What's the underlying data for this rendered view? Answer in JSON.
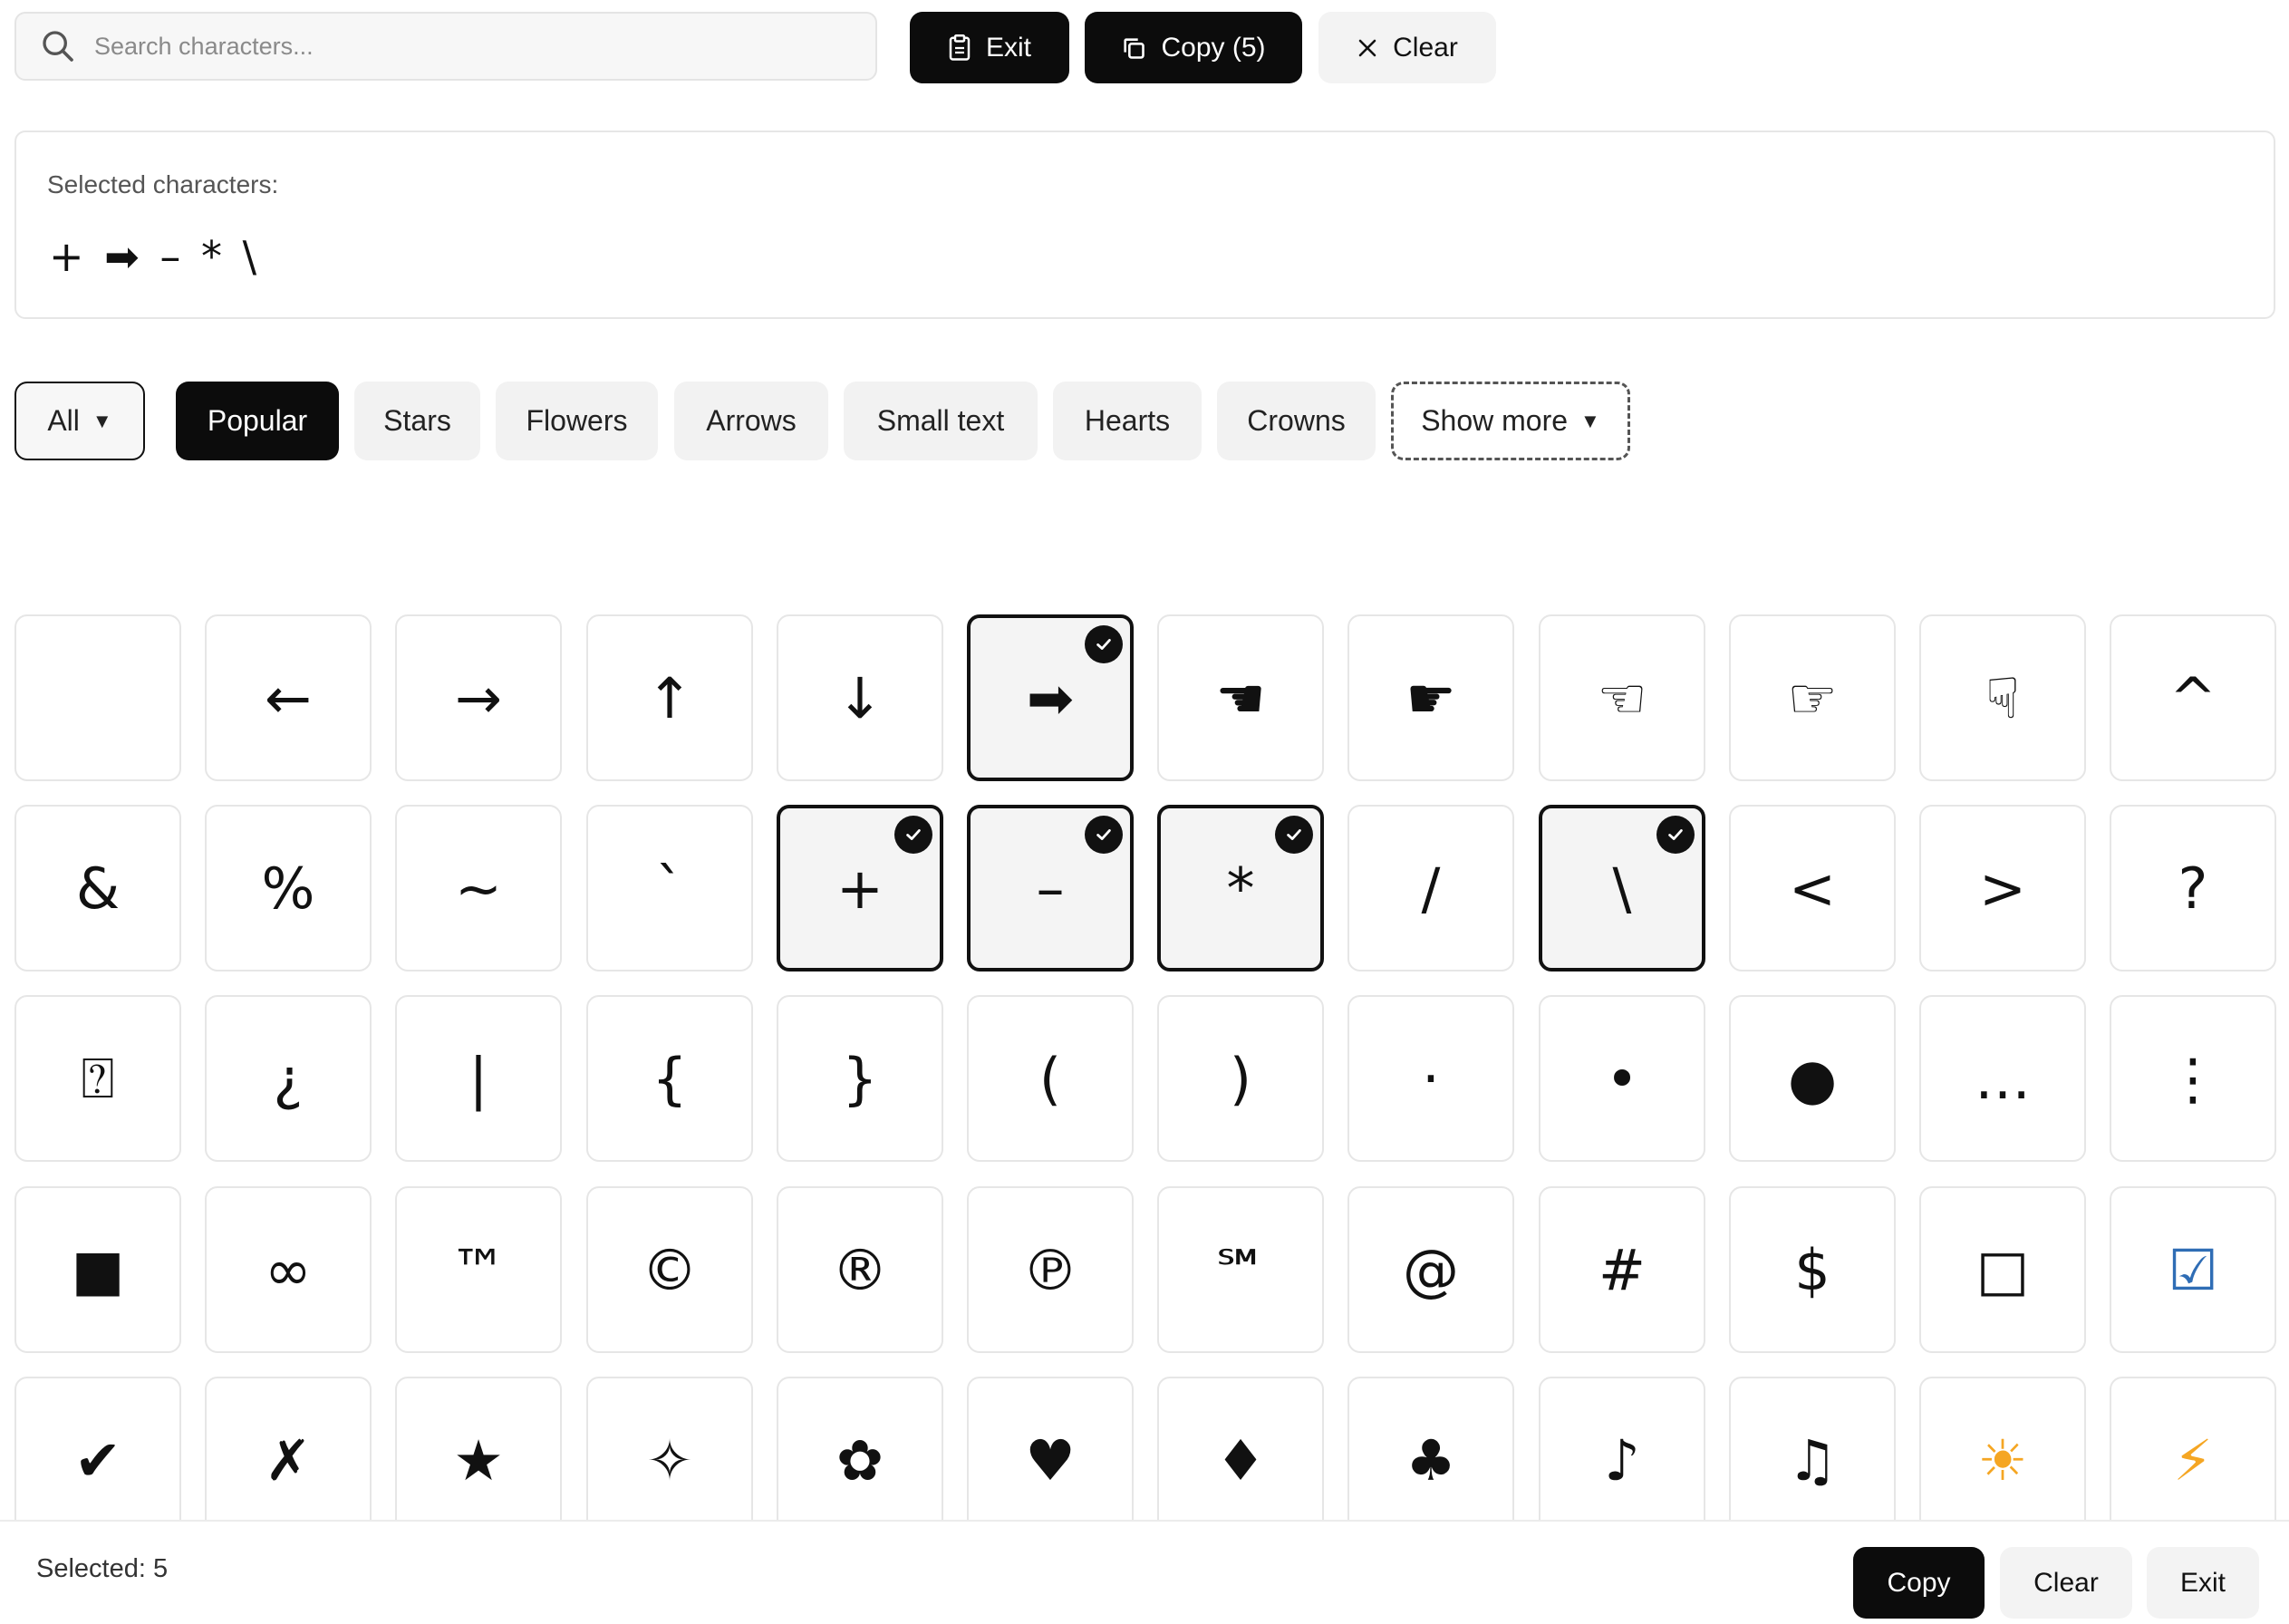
{
  "search": {
    "placeholder": "Search characters..."
  },
  "toolbar": {
    "exit_label": "Exit",
    "copy_label": "Copy (5)",
    "clear_label": "Clear"
  },
  "selected_panel": {
    "label": "Selected characters:",
    "chars": "+ ➡ – * \\"
  },
  "filters": {
    "all_label": "All",
    "categories": [
      "Popular",
      "Stars",
      "Flowers",
      "Arrows",
      "Small text",
      "Hearts",
      "Crowns"
    ],
    "active": "Popular",
    "show_more_label": "Show more"
  },
  "grid": {
    "tiles": [
      {
        "char": "",
        "selected": false
      },
      {
        "char": "←",
        "selected": false
      },
      {
        "char": "→",
        "selected": false
      },
      {
        "char": "↑",
        "selected": false
      },
      {
        "char": "↓",
        "selected": false
      },
      {
        "char": "➡",
        "selected": true
      },
      {
        "char": "☚",
        "selected": false
      },
      {
        "char": "☛",
        "selected": false
      },
      {
        "char": "☜",
        "selected": false
      },
      {
        "char": "☞",
        "selected": false
      },
      {
        "char": "☟",
        "selected": false
      },
      {
        "char": "^",
        "selected": false
      },
      {
        "char": "&",
        "selected": false
      },
      {
        "char": "%",
        "selected": false
      },
      {
        "char": "~",
        "selected": false
      },
      {
        "char": "`",
        "selected": false
      },
      {
        "char": "+",
        "selected": true
      },
      {
        "char": "–",
        "selected": true
      },
      {
        "char": "*",
        "selected": true
      },
      {
        "char": "/",
        "selected": false
      },
      {
        "char": "\\",
        "selected": true
      },
      {
        "char": "<",
        "selected": false
      },
      {
        "char": ">",
        "selected": false
      },
      {
        "char": "?",
        "selected": false
      },
      {
        "char": "⍰",
        "selected": false
      },
      {
        "char": "¿",
        "selected": false
      },
      {
        "char": "|",
        "selected": false
      },
      {
        "char": "{",
        "selected": false
      },
      {
        "char": "}",
        "selected": false
      },
      {
        "char": "(",
        "selected": false
      },
      {
        "char": ")",
        "selected": false
      },
      {
        "char": "·",
        "selected": false
      },
      {
        "char": "•",
        "selected": false
      },
      {
        "char": "●",
        "selected": false
      },
      {
        "char": "…",
        "selected": false
      },
      {
        "char": "⋮",
        "selected": false
      },
      {
        "char": "■",
        "selected": false
      },
      {
        "char": "∞",
        "selected": false
      },
      {
        "char": "™",
        "selected": false
      },
      {
        "char": "©",
        "selected": false
      },
      {
        "char": "®",
        "selected": false
      },
      {
        "char": "℗",
        "selected": false
      },
      {
        "char": "℠",
        "selected": false
      },
      {
        "char": "@",
        "selected": false
      },
      {
        "char": "#",
        "selected": false
      },
      {
        "char": "$",
        "selected": false
      },
      {
        "char": "□",
        "selected": false
      },
      {
        "char": "☑",
        "selected": false,
        "color": "#2f6db5"
      },
      {
        "char": "✔",
        "selected": false
      },
      {
        "char": "✗",
        "selected": false
      },
      {
        "char": "★",
        "selected": false
      },
      {
        "char": "✧",
        "selected": false
      },
      {
        "char": "✿",
        "selected": false
      },
      {
        "char": "♥",
        "selected": false
      },
      {
        "char": "♦",
        "selected": false
      },
      {
        "char": "♣",
        "selected": false
      },
      {
        "char": "♪",
        "selected": false
      },
      {
        "char": "♫",
        "selected": false
      },
      {
        "char": "☀",
        "selected": false,
        "color": "#f5a623"
      },
      {
        "char": "⚡",
        "selected": false,
        "color": "#f5a623"
      }
    ]
  },
  "bottom_bar": {
    "selected_count": "Selected: 5",
    "copy_label": "Copy",
    "clear_label": "Clear",
    "exit_label": "Exit"
  },
  "colors": {
    "primary_button": "#0c0c0c",
    "secondary_button": "#f3f3f3",
    "check_badge": "#111111",
    "sun_icon": "#f5a623",
    "bolt_icon": "#f5a623",
    "checkbox_icon": "#2f6db5"
  },
  "icons": {
    "search": "search-icon",
    "exit": "clipboard-icon",
    "copy": "copy-icon",
    "clear": "close-icon",
    "dropdown": "caret-down-icon",
    "selected_badge": "check-icon"
  }
}
